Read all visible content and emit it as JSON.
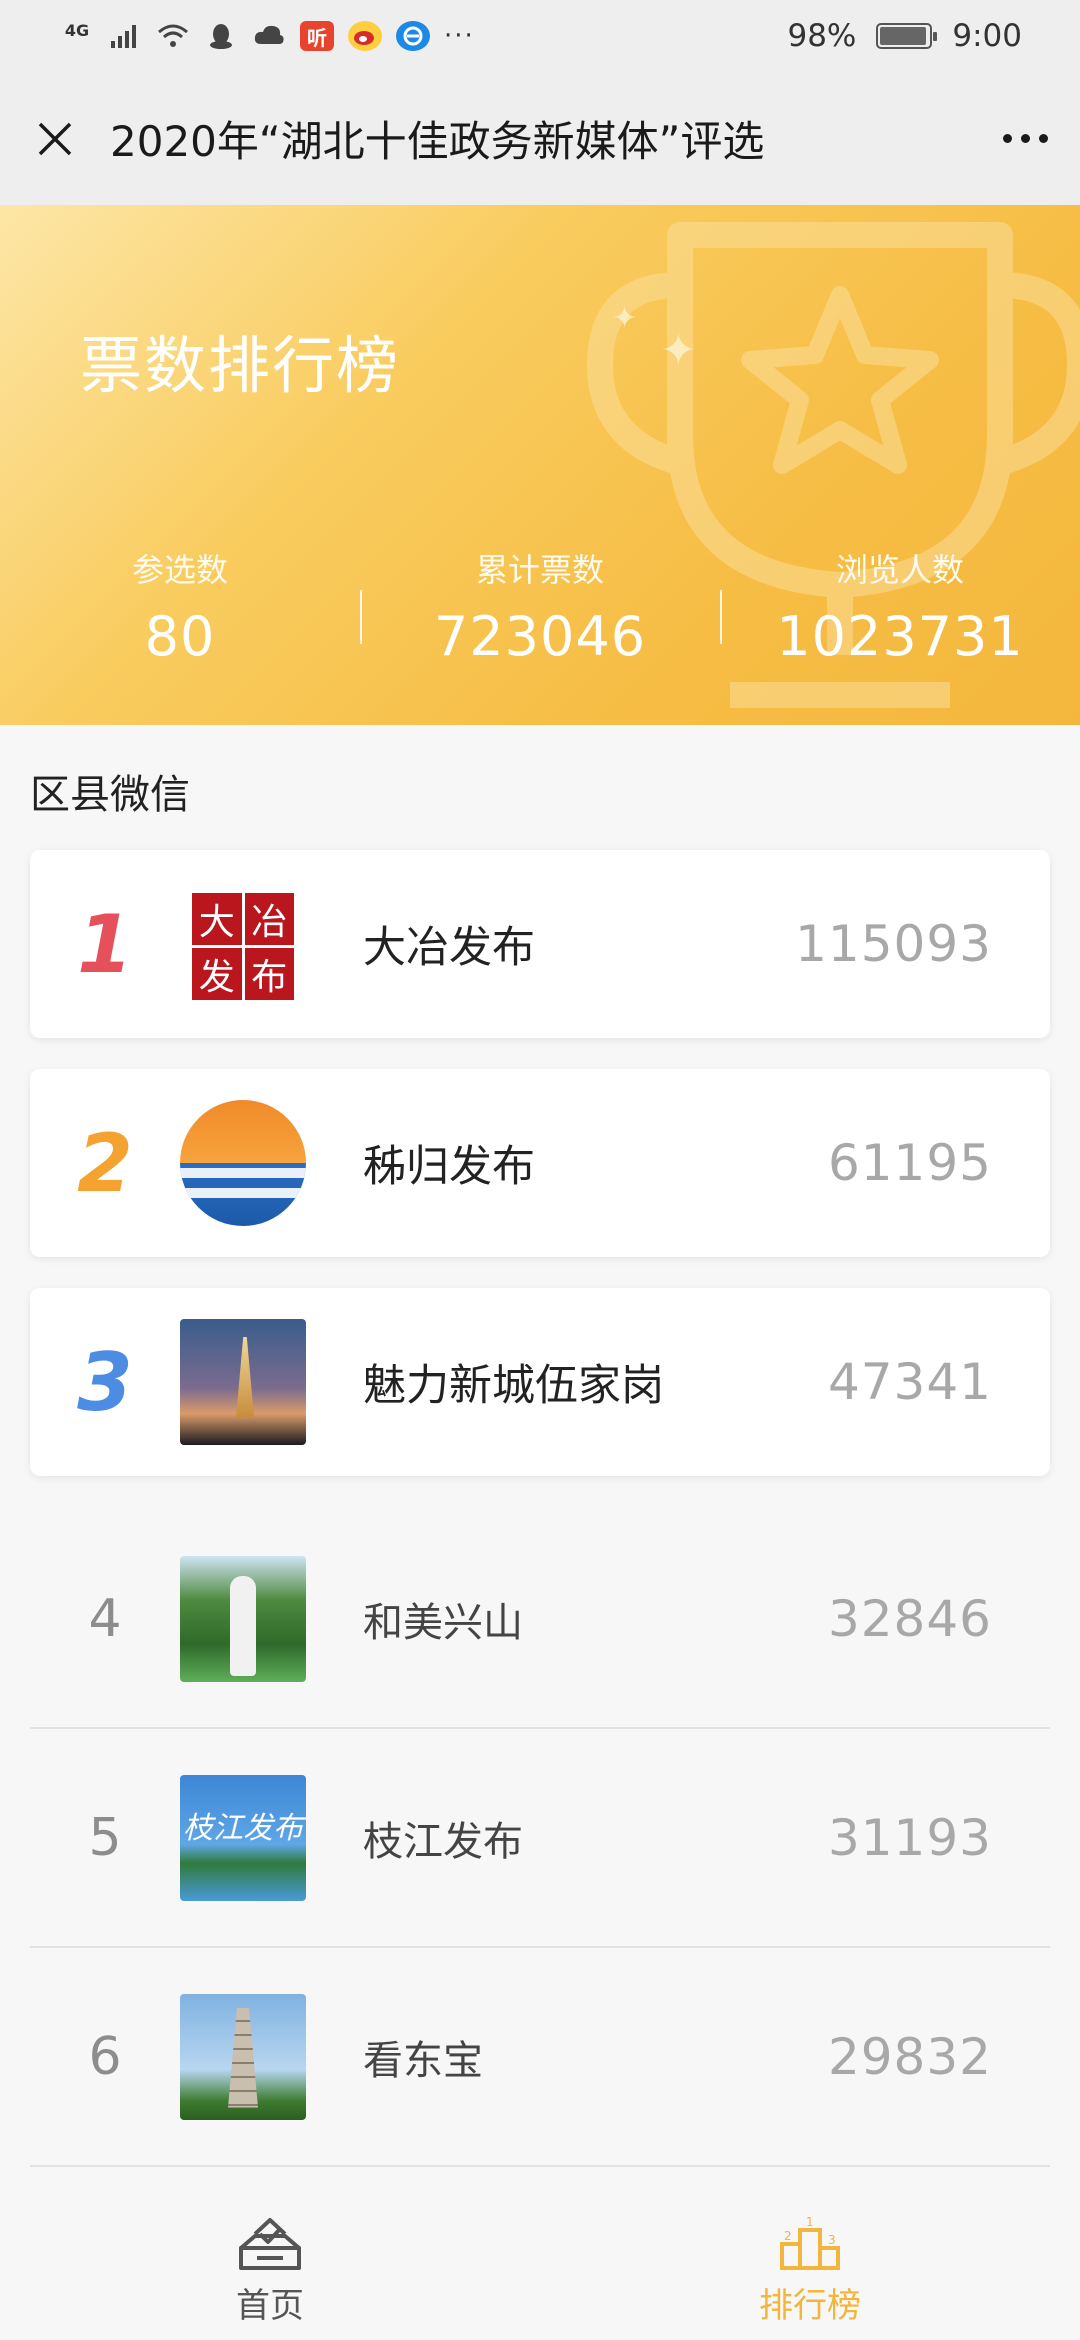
{
  "status_bar": {
    "network": "4G",
    "icons": [
      "signal-icon",
      "wifi-icon",
      "qq-icon",
      "cloud-icon",
      "ting-app-icon",
      "weibo-icon",
      "browser-icon"
    ],
    "ting_label": "听",
    "more": "···",
    "battery": "98%",
    "time": "9:00"
  },
  "header": {
    "title": "2020年“湖北十佳政务新媒体”评选"
  },
  "hero": {
    "title": "票数排行榜",
    "stats": [
      {
        "label": "参选数",
        "value": "80"
      },
      {
        "label": "累计票数",
        "value": "723046"
      },
      {
        "label": "浏览人数",
        "value": "1023731"
      }
    ]
  },
  "section": {
    "title": "区县微信"
  },
  "ranking": [
    {
      "rank": "1",
      "name": "大冶发布",
      "votes": "115093",
      "logo_text": [
        "大",
        "冶",
        "发",
        "布"
      ]
    },
    {
      "rank": "2",
      "name": "秭归发布",
      "votes": "61195"
    },
    {
      "rank": "3",
      "name": "魅力新城伍家岗",
      "votes": "47341"
    },
    {
      "rank": "4",
      "name": "和美兴山",
      "votes": "32846"
    },
    {
      "rank": "5",
      "name": "枝江发布",
      "votes": "31193",
      "logo_text": "枝江发布"
    },
    {
      "rank": "6",
      "name": "看东宝",
      "votes": "29832"
    }
  ],
  "bottom_nav": [
    {
      "label": "首页",
      "icon": "home-ballot-icon",
      "active": false
    },
    {
      "label": "排行榜",
      "icon": "podium-icon",
      "active": true
    }
  ],
  "colors": {
    "rank1": "#e5505a",
    "rank2": "#f5a330",
    "rank3": "#4c8de3",
    "accent": "#f2b53d"
  }
}
